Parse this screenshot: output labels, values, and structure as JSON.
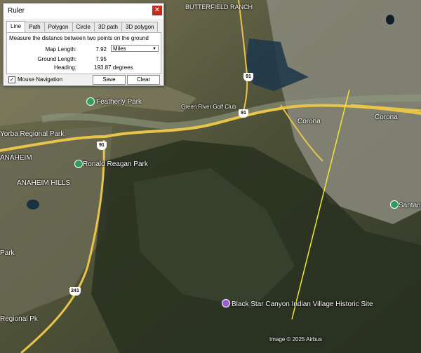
{
  "map": {
    "labels": {
      "butterfield_ranch": "BUTTERFIELD RANCH",
      "yorba_regional_park": "Yorba Regional Park",
      "featherly_park": "Featherly Park",
      "green_river_golf": "Green River Golf Club",
      "anaheim": "ANAHEIM",
      "anaheim_hills": "ANAHEIM HILLS",
      "ronald_reagan_park": "Ronald Reagan Park",
      "corona_left": "Corona",
      "corona_right": "Corona",
      "park_left": "Park",
      "regional_pk": "Regional Pk",
      "black_star": "Black Star Canyon Indian Village Historic Site",
      "santana_park": "Santana Park",
      "copyright": "Image © 2025 Airbus"
    },
    "shields": {
      "s91_a": "91",
      "s91_b": "91",
      "s91_c": "91",
      "s241": "241"
    },
    "colors": {
      "ruler_line": "#f0e830",
      "highway": "#e8c44a",
      "poi_green": "#2e9d5a",
      "poi_purple": "#9b5fcf"
    }
  },
  "ruler": {
    "title": "Ruler",
    "close_icon": "close-icon",
    "tabs": [
      "Line",
      "Path",
      "Polygon",
      "Circle",
      "3D path",
      "3D polygon"
    ],
    "active_tab": "Line",
    "description": "Measure the distance between two points on the ground",
    "map_length_label": "Map Length:",
    "map_length_value": "7.92",
    "unit": "Miles",
    "ground_length_label": "Ground Length:",
    "ground_length_value": "7.95",
    "heading_label": "Heading:",
    "heading_value": "193.87 degrees",
    "mouse_nav_checked": true,
    "mouse_nav_label": "Mouse Navigation",
    "save_label": "Save",
    "clear_label": "Clear"
  }
}
